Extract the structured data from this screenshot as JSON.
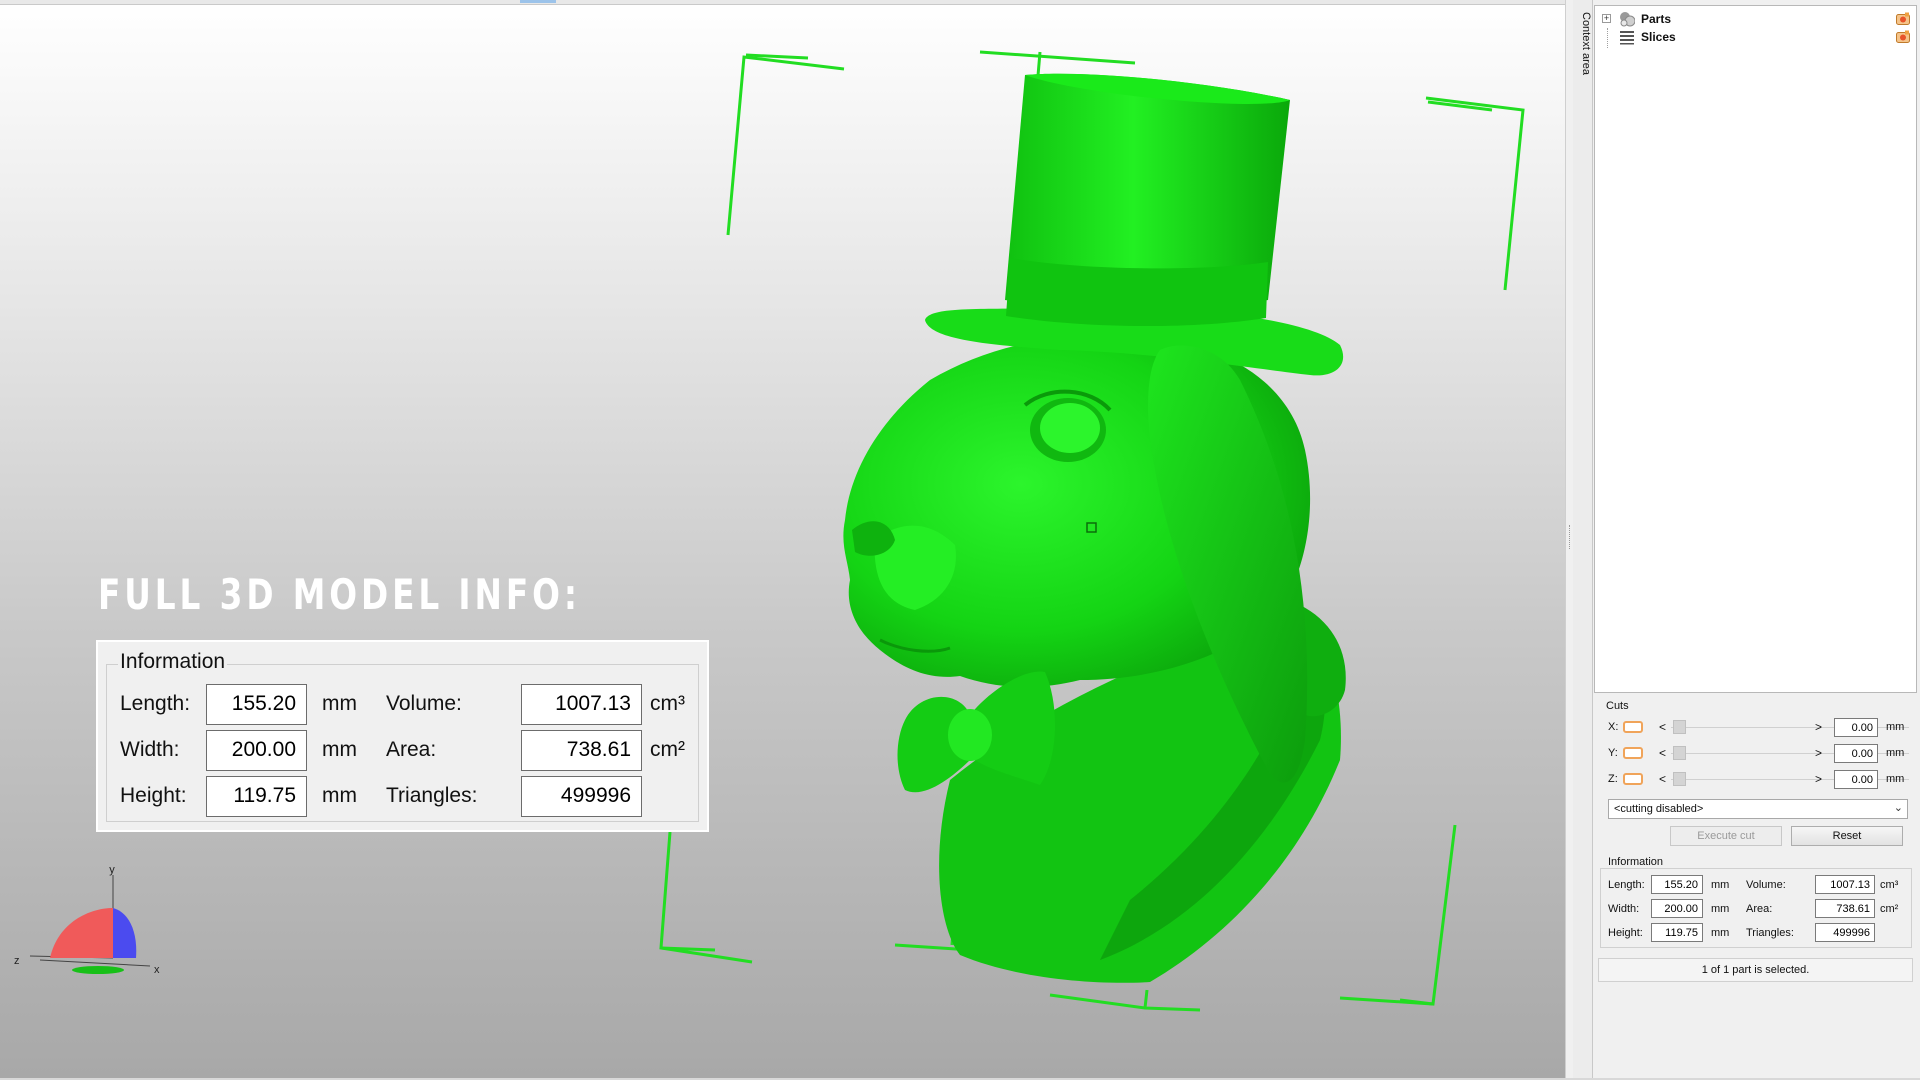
{
  "viewport": {
    "overlay_title": "FULL 3D MODEL INFO:",
    "overlay_info": {
      "legend": "Information",
      "length_label": "Length:",
      "length_value": "155.20",
      "length_unit": "mm",
      "width_label": "Width:",
      "width_value": "200.00",
      "width_unit": "mm",
      "height_label": "Height:",
      "height_value": "119.75",
      "height_unit": "mm",
      "volume_label": "Volume:",
      "volume_value": "1007.13",
      "volume_unit": "cm³",
      "area_label": "Area:",
      "area_value": "738.61",
      "area_unit": "cm²",
      "triangles_label": "Triangles:",
      "triangles_value": "499996"
    },
    "axes": {
      "x": "x",
      "y": "y",
      "z": "z"
    },
    "model_color": "#14e214",
    "bbox_color": "#22dd22"
  },
  "dock": {
    "vertical_tab": "Context area",
    "tree": [
      {
        "label": "Parts",
        "icon": "parts-icon"
      },
      {
        "label": "Slices",
        "icon": "slices-icon"
      }
    ],
    "cuts": {
      "title": "Cuts",
      "rows": [
        {
          "axis": "X:",
          "value": "0.00",
          "unit": "mm"
        },
        {
          "axis": "Y:",
          "value": "0.00",
          "unit": "mm"
        },
        {
          "axis": "Z:",
          "value": "0.00",
          "unit": "mm"
        }
      ],
      "mode": "<cutting disabled>",
      "execute_label": "Execute cut",
      "reset_label": "Reset"
    },
    "info": {
      "title": "Information",
      "length_label": "Length:",
      "length_value": "155.20",
      "length_unit": "mm",
      "width_label": "Width:",
      "width_value": "200.00",
      "width_unit": "mm",
      "height_label": "Height:",
      "height_value": "119.75",
      "height_unit": "mm",
      "volume_label": "Volume:",
      "volume_value": "1007.13",
      "volume_unit": "cm³",
      "area_label": "Area:",
      "area_value": "738.61",
      "area_unit": "cm²",
      "triangles_label": "Triangles:",
      "triangles_value": "499996"
    },
    "status": "1 of 1 part is selected."
  }
}
